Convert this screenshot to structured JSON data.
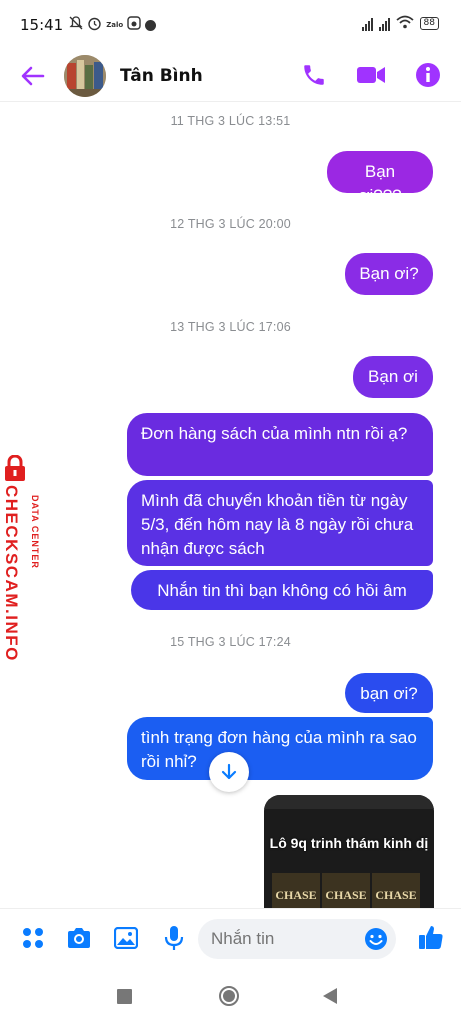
{
  "status": {
    "time": "15:41",
    "zalo_label": "Zalo",
    "battery": "88"
  },
  "header": {
    "contact_name": "Tân Bình"
  },
  "colors": {
    "accent": "#a033ff",
    "bubble_purple": "#9b28e3",
    "bubble_violet": "#6a2be0",
    "bubble_indigo": "#4a36e8",
    "bubble_blue": "#1b5ef2",
    "timestamp": "#8a8d91",
    "composer_blue": "#0a7cff"
  },
  "messages": {
    "ts1": "11 THG 3 LÚC 13:51",
    "m1": "Bạn ơi???",
    "ts2": "12 THG 3 LÚC 20:00",
    "m2": "Bạn ơi?",
    "ts3": "13 THG 3 LÚC 17:06",
    "m3": "Bạn ơi",
    "m4": "Đơn hàng sách của mình ntn rồi ạ?",
    "m5": "Mình đã chuyển khoản tiền từ ngày 5/3, đến hôm nay là 8 ngày rồi chưa nhận được sách",
    "m6": "Nhắn tin thì bạn không có hồi âm",
    "ts4": "15 THG 3 LÚC 17:24",
    "m7": "bạn ơi?",
    "m8": "tình trạng đơn hàng của mình ra sao rồi nhỉ?",
    "image_caption": "Lô 9q trinh thám kinh dị",
    "book_titles": [
      "CHASE",
      "CHASE",
      "CHASE"
    ]
  },
  "watermark": {
    "brand": "CHECKSCAM.INFO",
    "sub": "DATA CENTER"
  },
  "composer": {
    "placeholder": "Nhắn tin"
  }
}
